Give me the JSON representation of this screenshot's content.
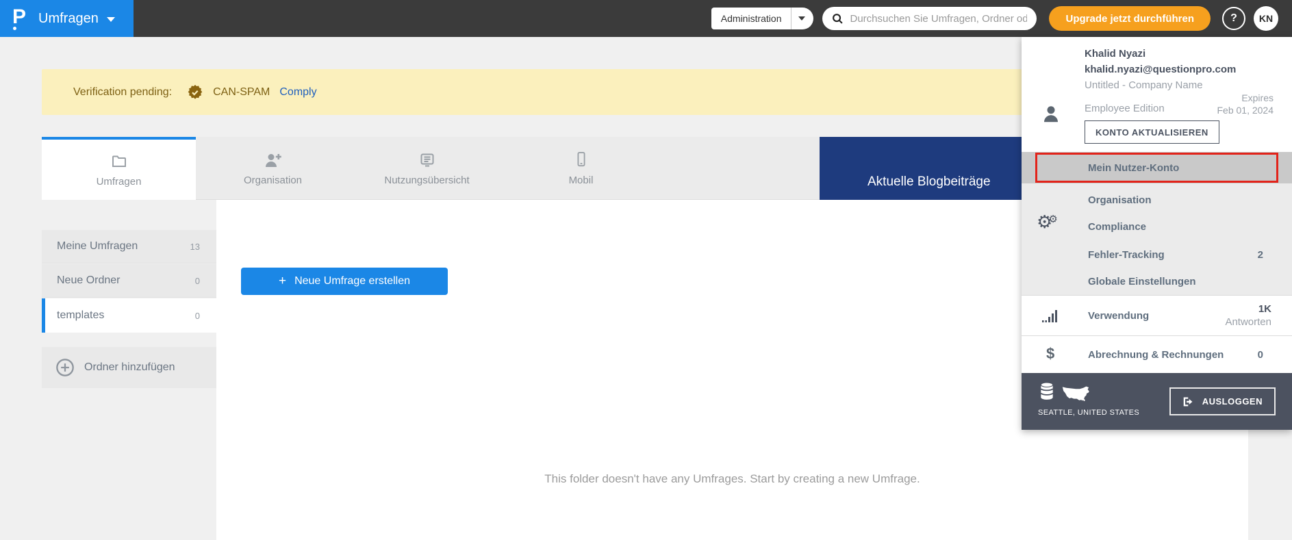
{
  "topbar": {
    "logo_letter": "P",
    "product": "Umfragen",
    "admin_label": "Administration",
    "search_placeholder": "Durchsuchen Sie Umfragen, Ordner oder",
    "upgrade_label": "Upgrade jetzt durchführen",
    "help_label": "?",
    "avatar_initials": "KN"
  },
  "banner": {
    "status_label": "Verification pending:",
    "program": "CAN-SPAM",
    "link": "Comply"
  },
  "tabs": [
    {
      "label": "Umfragen",
      "active": true
    },
    {
      "label": "Organisation",
      "active": false
    },
    {
      "label": "Nutzungsübersicht",
      "active": false
    },
    {
      "label": "Mobil",
      "active": false
    }
  ],
  "blog_panel": {
    "label": "Aktuelle Blogbeiträge"
  },
  "sidebar": {
    "items": [
      {
        "label": "Meine Umfragen",
        "count": "13"
      },
      {
        "label": "Neue Ordner",
        "count": "0"
      },
      {
        "label": "templates",
        "count": "0"
      }
    ],
    "add_folder_label": "Ordner hinzufügen"
  },
  "content": {
    "create_plus": "+",
    "create_label": "Neue Umfrage erstellen",
    "empty_text": "This folder doesn't have any Umfrages. Start by creating a new Umfrage."
  },
  "user_panel": {
    "name": "Khalid Nyazi",
    "email": "khalid.nyazi@questionpro.com",
    "company": "Untitled - Company Name",
    "edition": "Employee Edition",
    "update_button": "KONTO AKTUALISIEREN",
    "expires_line1": "Expires",
    "expires_line2": "Feb 01, 2024",
    "menu": [
      {
        "label": "Mein Nutzer-Konto"
      },
      {
        "label": "Organisation"
      },
      {
        "label": "Compliance"
      },
      {
        "label": "Fehler-Tracking",
        "badge": "2"
      },
      {
        "label": "Globale Einstellungen"
      }
    ],
    "usage": {
      "label": "Verwendung",
      "value": "1K",
      "unit": "Antworten"
    },
    "billing": {
      "label": "Abrechnung & Rechnungen",
      "badge": "0"
    },
    "footer": {
      "location": "SEATTLE, UNITED STATES",
      "logout": "AUSLOGGEN"
    }
  },
  "colors": {
    "brand_blue": "#1b87e6",
    "upgrade_orange": "#f6a01e",
    "banner_yellow": "#fbf0bd",
    "blog_navy": "#1e3b7e",
    "highlight_red": "#e2231a",
    "footer_slate": "#4c5260"
  }
}
